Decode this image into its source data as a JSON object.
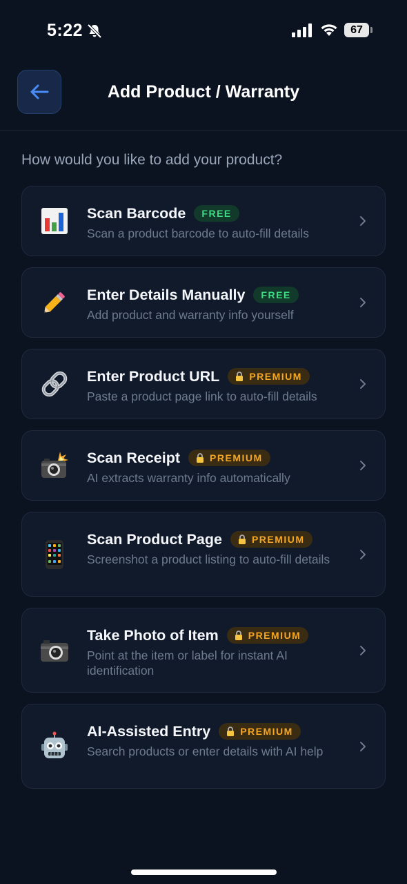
{
  "status_bar": {
    "time": "5:22",
    "battery": "67"
  },
  "header": {
    "title": "Add Product / Warranty"
  },
  "prompt": "How would you like to add your product?",
  "options": [
    {
      "title": "Scan Barcode",
      "badge": "FREE",
      "tier": "free",
      "description": "Scan a product barcode to auto-fill details",
      "icon": "bar-chart-icon"
    },
    {
      "title": "Enter Details Manually",
      "badge": "FREE",
      "tier": "free",
      "description": "Add product and warranty info yourself",
      "icon": "pencil-icon"
    },
    {
      "title": "Enter Product URL",
      "badge": "PREMIUM",
      "tier": "premium",
      "description": "Paste a product page link to auto-fill details",
      "icon": "link-icon"
    },
    {
      "title": "Scan Receipt",
      "badge": "PREMIUM",
      "tier": "premium",
      "description": "AI extracts warranty info automatically",
      "icon": "camera-flash-icon"
    },
    {
      "title": "Scan Product Page",
      "badge": "PREMIUM",
      "tier": "premium",
      "description": "Screenshot a product listing to auto-fill details",
      "icon": "phone-icon"
    },
    {
      "title": "Take Photo of Item",
      "badge": "PREMIUM",
      "tier": "premium",
      "description": "Point at the item or label for instant AI identification",
      "icon": "camera-icon"
    },
    {
      "title": "AI-Assisted Entry",
      "badge": "PREMIUM",
      "tier": "premium",
      "description": "Search products or enter details with AI help",
      "icon": "robot-icon"
    }
  ],
  "colors": {
    "background": "#0b1220",
    "card": "#111a2b",
    "free_badge": "#3ddc84",
    "premium_badge": "#f5a623",
    "back_arrow": "#4a8cf7"
  }
}
